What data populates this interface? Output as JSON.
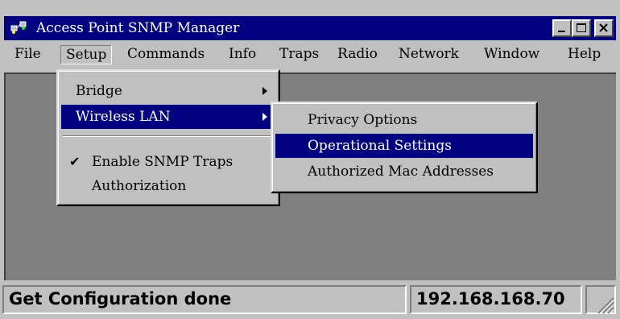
{
  "window": {
    "title": "Access Point SNMP Manager",
    "icon": "network-computers-icon"
  },
  "menubar": {
    "items": [
      "File",
      "Setup",
      "Commands",
      "Info",
      "Traps",
      "Radio",
      "Network",
      "Window",
      "Help"
    ],
    "open_item": "Setup"
  },
  "setup_menu": {
    "items": [
      {
        "label": "Bridge",
        "submenu": true
      },
      {
        "label": "Wireless LAN",
        "submenu": true,
        "highlighted": true
      },
      {
        "label": "Enable SNMP Traps",
        "checked": true
      },
      {
        "label": "Authorization"
      }
    ]
  },
  "wireless_lan_menu": {
    "items": [
      {
        "label": "Privacy Options"
      },
      {
        "label": "Operational Settings",
        "highlighted": true
      },
      {
        "label": "Authorized Mac Addresses"
      }
    ]
  },
  "status": {
    "message": "Get Configuration done",
    "ip_address": "192.168.168.70",
    "extra": ""
  },
  "colors": {
    "titlebar": "#000080",
    "highlight": "#000080",
    "face": "#c0c0c0",
    "client": "#808080"
  }
}
